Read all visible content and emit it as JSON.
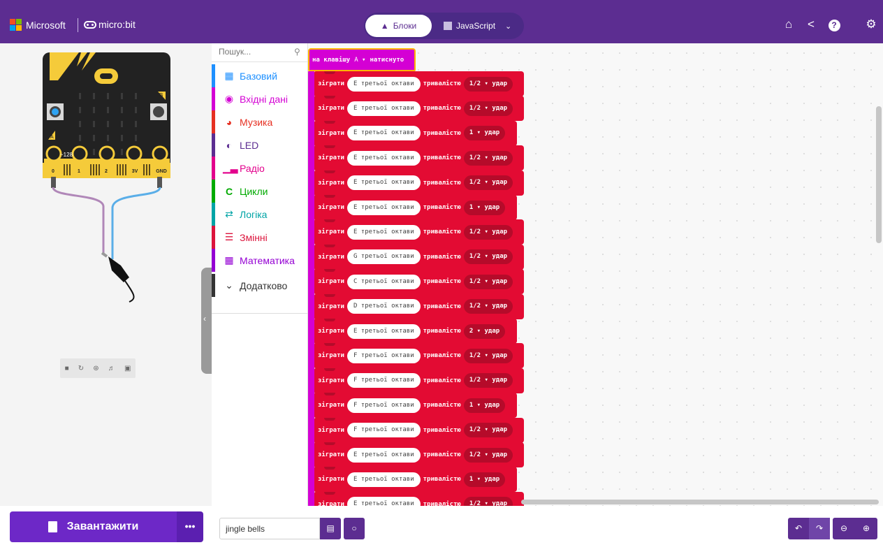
{
  "header": {
    "brand": "Microsoft",
    "product": "micro:bit",
    "tabs": [
      {
        "label": "Блоки",
        "active": true
      },
      {
        "label": "JavaScript",
        "active": false
      }
    ],
    "icons": [
      "home-icon",
      "share-icon",
      "help-icon",
      "settings-icon"
    ]
  },
  "simulator": {
    "pin_labels": [
      "0",
      "1",
      "2",
      "3V",
      "GND"
    ],
    "pin_value": "~128",
    "button_a": "A",
    "button_b": "B",
    "controls": [
      "stop-icon",
      "restart-icon",
      "debug-icon",
      "mute-icon",
      "fullscreen-icon"
    ]
  },
  "toolbox": {
    "search_placeholder": "Пошук...",
    "categories": [
      {
        "label": "Базовий",
        "color": "#1e90ff",
        "icon": "grid-icon"
      },
      {
        "label": "Вхідні дані",
        "color": "#d400d4",
        "icon": "input-icon"
      },
      {
        "label": "Музика",
        "color": "#e63022",
        "icon": "headphones-icon"
      },
      {
        "label": "LED",
        "color": "#5c2d91",
        "icon": "toggle-icon"
      },
      {
        "label": "Радіо",
        "color": "#e3008c",
        "icon": "signal-icon"
      },
      {
        "label": "Цикли",
        "color": "#00aa00",
        "icon": "loop-icon"
      },
      {
        "label": "Логіка",
        "color": "#00a4a6",
        "icon": "shuffle-icon"
      },
      {
        "label": "Змінні",
        "color": "#dc143c",
        "icon": "list-icon"
      },
      {
        "label": "Математика",
        "color": "#9400d3",
        "icon": "calculator-icon"
      },
      {
        "label": "Додатково",
        "color": "#333333",
        "icon": "chevron-down-icon"
      }
    ]
  },
  "workspace": {
    "event_block": {
      "prefix": "на клавішу",
      "button": "A ▾",
      "suffix": "натиснуто"
    },
    "play_keyword": "зіграти",
    "octave_suffix": "третьої октави",
    "duration_keyword": "тривалістю",
    "beat_word": "удар",
    "notes": [
      {
        "pitch": "E",
        "beats": "1/2"
      },
      {
        "pitch": "E",
        "beats": "1/2"
      },
      {
        "pitch": "E",
        "beats": "1"
      },
      {
        "pitch": "E",
        "beats": "1/2"
      },
      {
        "pitch": "E",
        "beats": "1/2"
      },
      {
        "pitch": "E",
        "beats": "1"
      },
      {
        "pitch": "E",
        "beats": "1/2"
      },
      {
        "pitch": "G",
        "beats": "1/2"
      },
      {
        "pitch": "C",
        "beats": "1/2"
      },
      {
        "pitch": "D",
        "beats": "1/2"
      },
      {
        "pitch": "E",
        "beats": "2"
      },
      {
        "pitch": "F",
        "beats": "1/2"
      },
      {
        "pitch": "F",
        "beats": "1/2"
      },
      {
        "pitch": "F",
        "beats": "1"
      },
      {
        "pitch": "F",
        "beats": "1/2"
      },
      {
        "pitch": "E",
        "beats": "1/2"
      },
      {
        "pitch": "E",
        "beats": "1"
      },
      {
        "pitch": "E",
        "beats": "1/2"
      }
    ]
  },
  "bottombar": {
    "download_label": "Завантажити",
    "more_label": "•••",
    "project_name": "jingle bells",
    "icons": [
      "save-icon",
      "github-icon",
      "undo-icon",
      "redo-icon",
      "zoom-out-icon",
      "zoom-in-icon"
    ]
  },
  "colors": {
    "header": "#5c2d91",
    "music_block": "#e30b33",
    "event_block": "#d400d4",
    "download": "#6d28c7"
  }
}
